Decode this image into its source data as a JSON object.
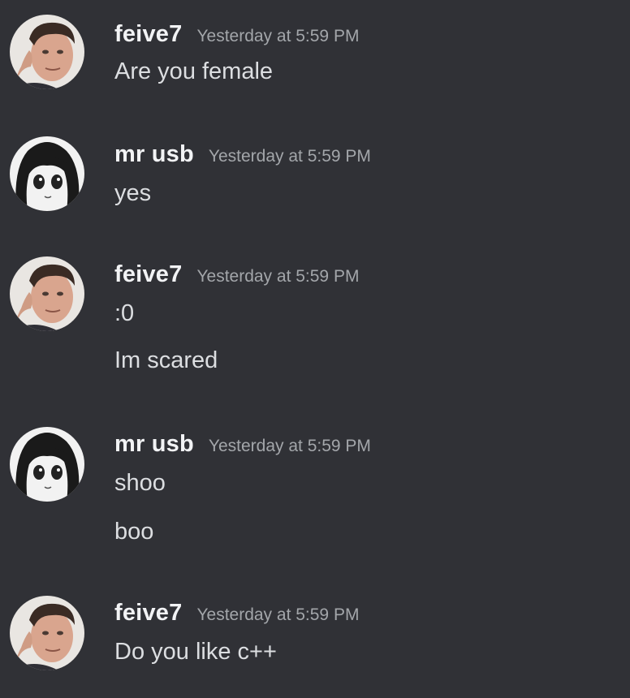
{
  "messages": [
    {
      "username": "feive7",
      "timestamp": "Yesterday at 5:59 PM",
      "avatar_icon": "man-photo-avatar",
      "lines": [
        "Are you female"
      ]
    },
    {
      "username": "mr usb",
      "timestamp": "Yesterday at 5:59 PM",
      "avatar_icon": "anime-girl-avatar",
      "lines": [
        "yes"
      ]
    },
    {
      "username": "feive7",
      "timestamp": "Yesterday at 5:59 PM",
      "avatar_icon": "man-photo-avatar",
      "lines": [
        ":0",
        "Im scared"
      ]
    },
    {
      "username": "mr usb",
      "timestamp": "Yesterday at 5:59 PM",
      "avatar_icon": "anime-girl-avatar",
      "lines": [
        "shoo",
        "boo"
      ]
    },
    {
      "username": "feive7",
      "timestamp": "Yesterday at 5:59 PM",
      "avatar_icon": "man-photo-avatar",
      "lines": [
        "Do you like c++"
      ]
    }
  ],
  "colors": {
    "background": "#303136",
    "username": "#f2f3f5",
    "timestamp": "#a3a6aa",
    "message_text": "#dcdee1"
  }
}
